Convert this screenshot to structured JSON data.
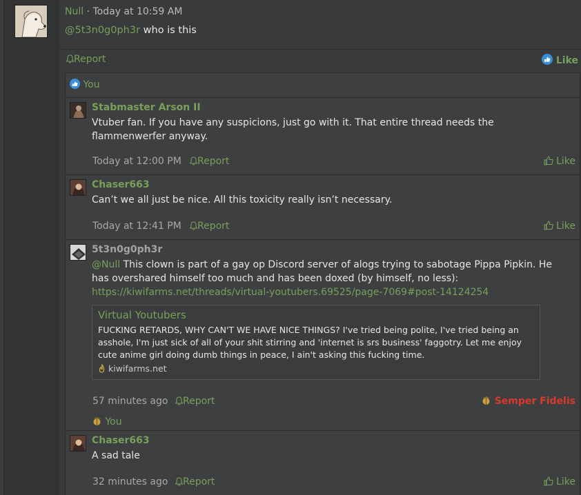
{
  "post": {
    "author": "Null",
    "separator": " · ",
    "time": "Today at 10:59 AM",
    "mention": "@5t3n0g0ph3r",
    "text": " who is this",
    "report": "Report",
    "like": "Like"
  },
  "reactions_bar": {
    "label": "You"
  },
  "comments": [
    {
      "author": "Stabmaster Arson II",
      "body": "Vtuber fan. If you have any suspicions, just go with it. That entire thread needs the flammenwerfer anyway.",
      "time": "Today at 12:00 PM",
      "report": "Report",
      "like": "Like"
    },
    {
      "author": "Chaser663",
      "body": "Can’t we all just be nice. All this toxicity really isn’t necessary.",
      "time": "Today at 12:41 PM",
      "report": "Report",
      "like": "Like"
    },
    {
      "author": "5t3n0g0ph3r",
      "mention": "@Null",
      "body": " This clown is part of a gay op Discord server of alogs trying to sabotage Pippa Pipkin. He has overshared himself too much and has been doxed (by himself, no less):",
      "link": "https://kiwifarms.net/threads/virtual-youtubers.69525/page-7069#post-14124254",
      "embed": {
        "title": "Virtual Youtubers",
        "text": "FUCKING RETARDS, WHY CAN'T WE HAVE NICE THINGS? I've tried being polite, I've tried being an asshole, I'm just sick of all of your shit stirring and 'internet is srs business' faggotry. Let me enjoy cute anime girl doing dumb things in peace, I ain't asking this fucking time.",
        "source": "kiwifarms.net"
      },
      "time": "57 minutes ago",
      "report": "Report",
      "reaction": "Semper Fidelis",
      "reacted": "You"
    },
    {
      "author": "Chaser663",
      "body": "A sad tale",
      "time": "32 minutes ago",
      "report": "Report",
      "like": "Like"
    }
  ],
  "colors": {
    "accent": "#78a05a",
    "reaction": "#d83a2b"
  }
}
